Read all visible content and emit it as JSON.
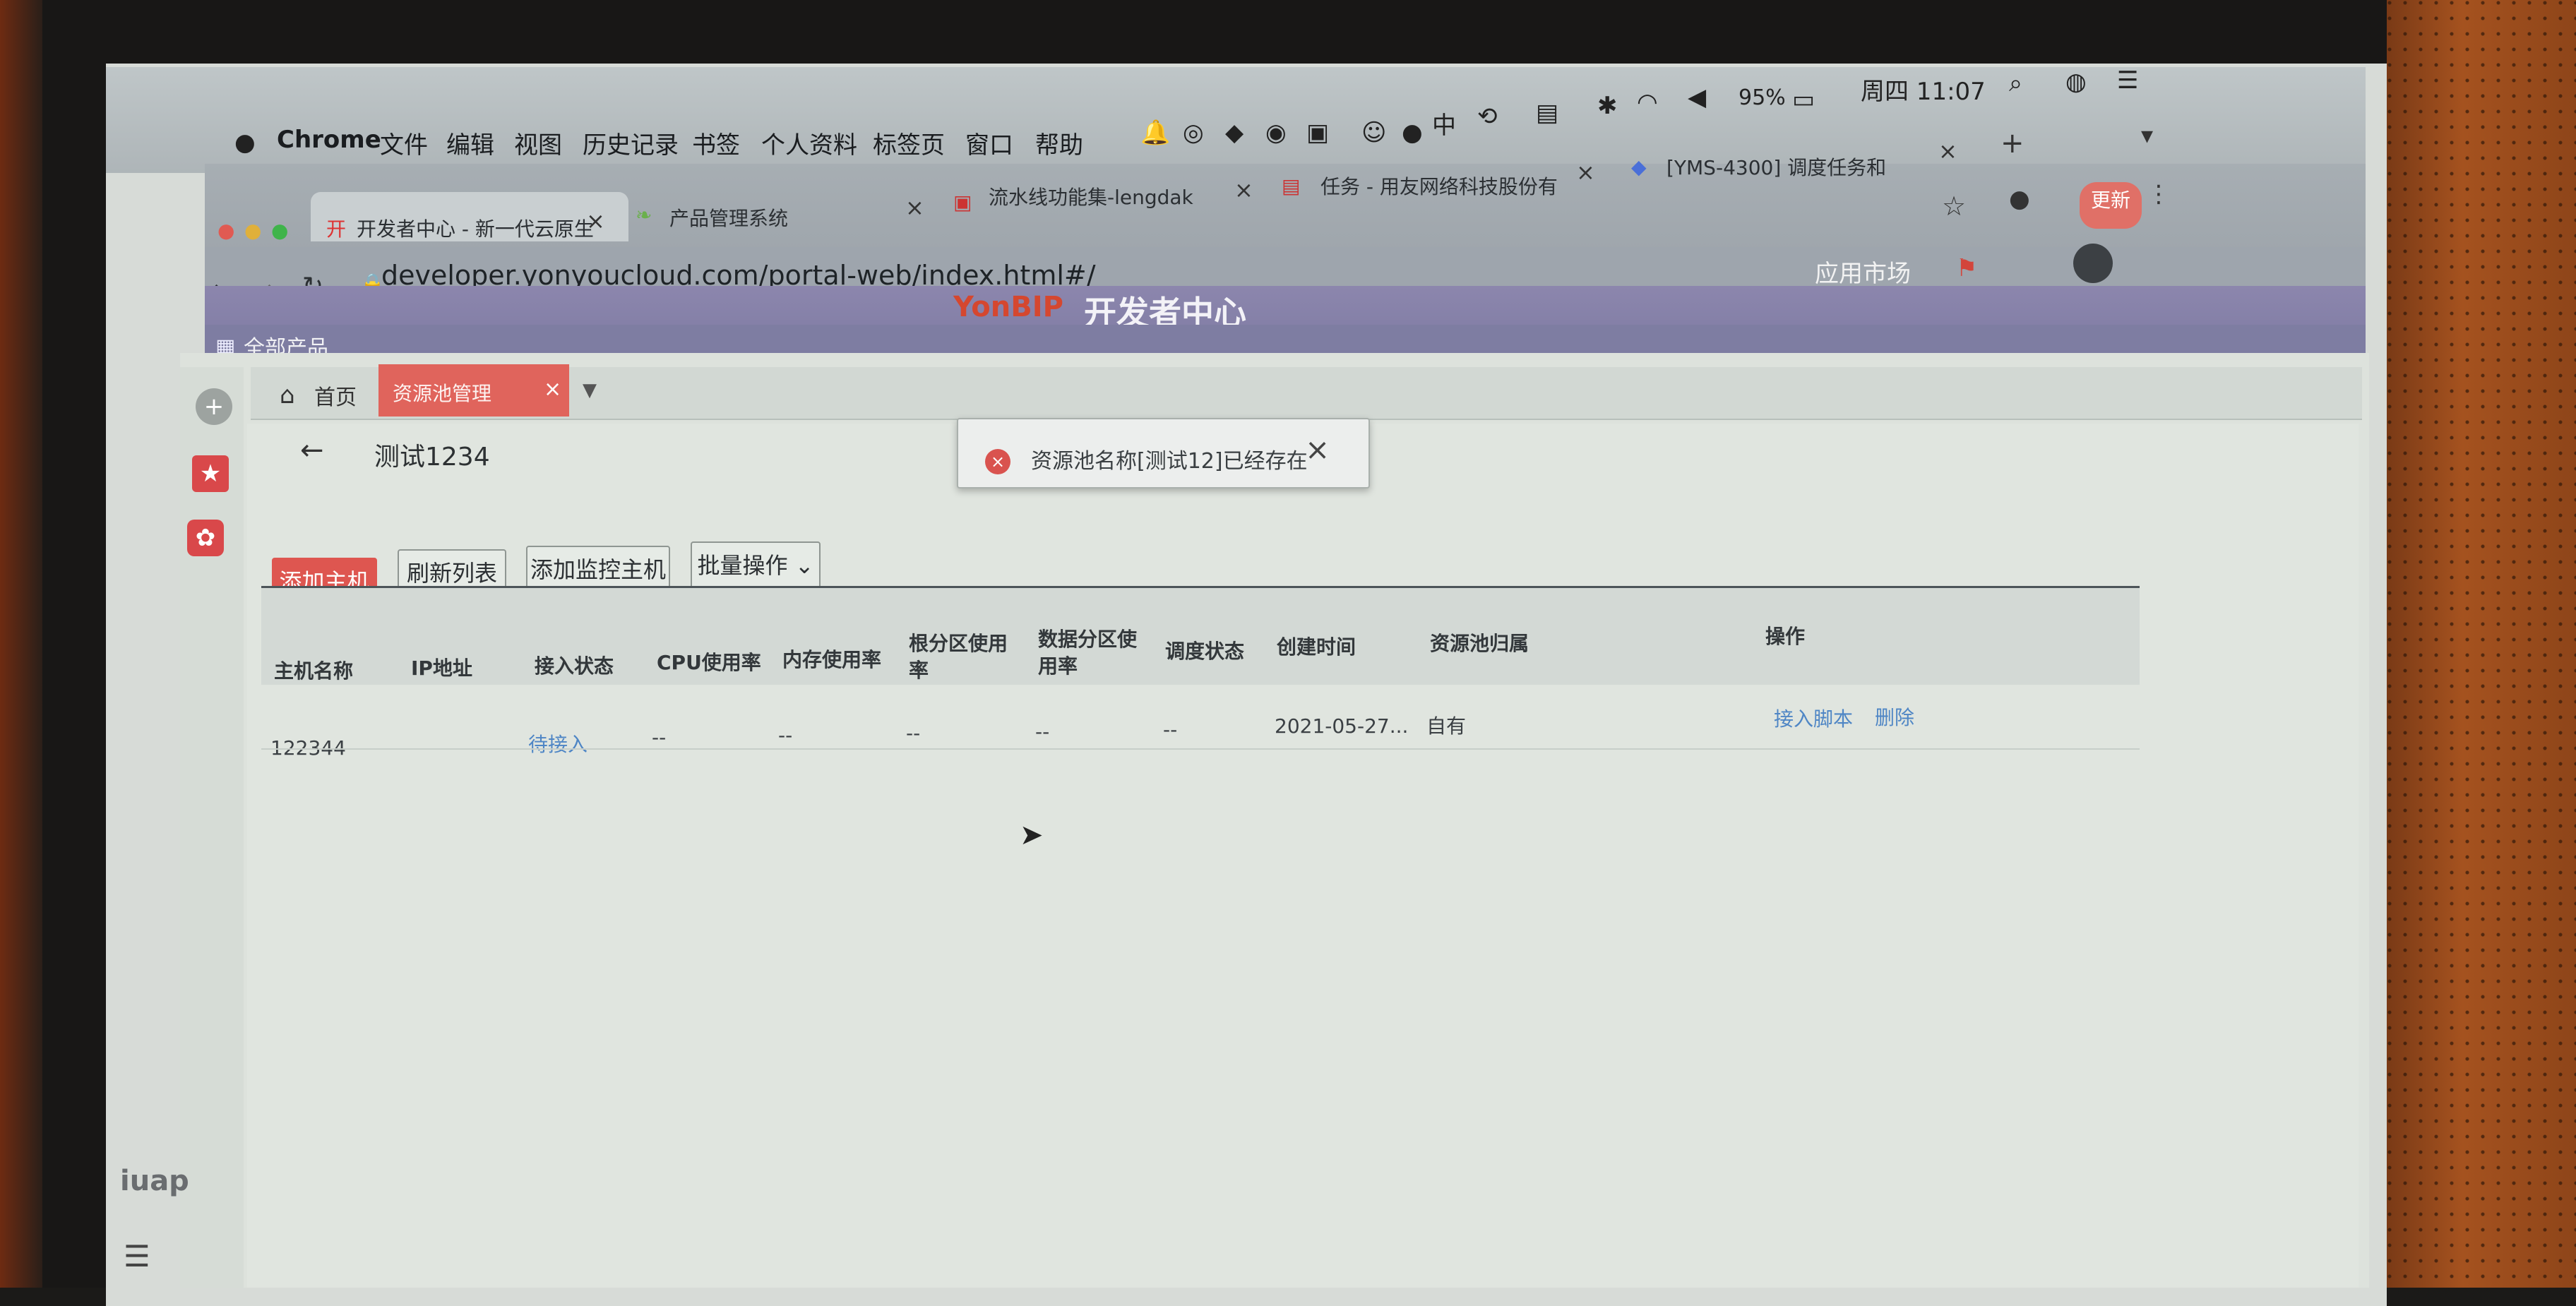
{
  "menubar": {
    "apple": "",
    "items": [
      "Chrome",
      "文件",
      "编辑",
      "视图",
      "历史记录",
      "书签",
      "个人资料",
      "标签页",
      "窗口",
      "帮助"
    ],
    "input_method": "中",
    "battery": "95%",
    "clock": "周四 11:07"
  },
  "tabs": [
    {
      "label": "开发者中心 - 新一代云原生",
      "icon": "yonyou-icon"
    },
    {
      "label": "产品管理系统",
      "icon": "leaf-icon"
    },
    {
      "label": "流水线功能集-lengdak",
      "icon": "pipeline-icon"
    },
    {
      "label": "任务 - 用友网络科技股份有",
      "icon": "task-icon"
    },
    {
      "label": "[YMS-4300] 调度任务和",
      "icon": "jira-icon"
    }
  ],
  "address": {
    "url": "developer.yonyoucloud.com/portal-web/index.html#/"
  },
  "header": {
    "logo": "YonBIP",
    "title": "开发者中心",
    "market": "应用市场",
    "all_products": "全部产品",
    "update": "更新"
  },
  "page_tabs": {
    "home": "首页",
    "pool": "资源池管理"
  },
  "page": {
    "title": "测试1234",
    "buttons": [
      "添加主机",
      "刷新列表",
      "添加监控主机",
      "批量操作"
    ]
  },
  "toast": {
    "message": "资源池名称[测试12]已经存在"
  },
  "table": {
    "headers": [
      "主机名称",
      "IP地址",
      "接入状态",
      "CPU使用率",
      "内存使用率",
      "根分区使用率",
      "数据分区使用率",
      "调度状态",
      "创建时间",
      "资源池归属",
      "操作"
    ],
    "rows": [
      [
        "122344",
        "",
        "待接入",
        "--",
        "--",
        "--",
        "--",
        "--",
        "2021-05-27...",
        "自有",
        "接入脚本",
        "删除"
      ]
    ]
  },
  "footer": {
    "brand": "iuap"
  }
}
